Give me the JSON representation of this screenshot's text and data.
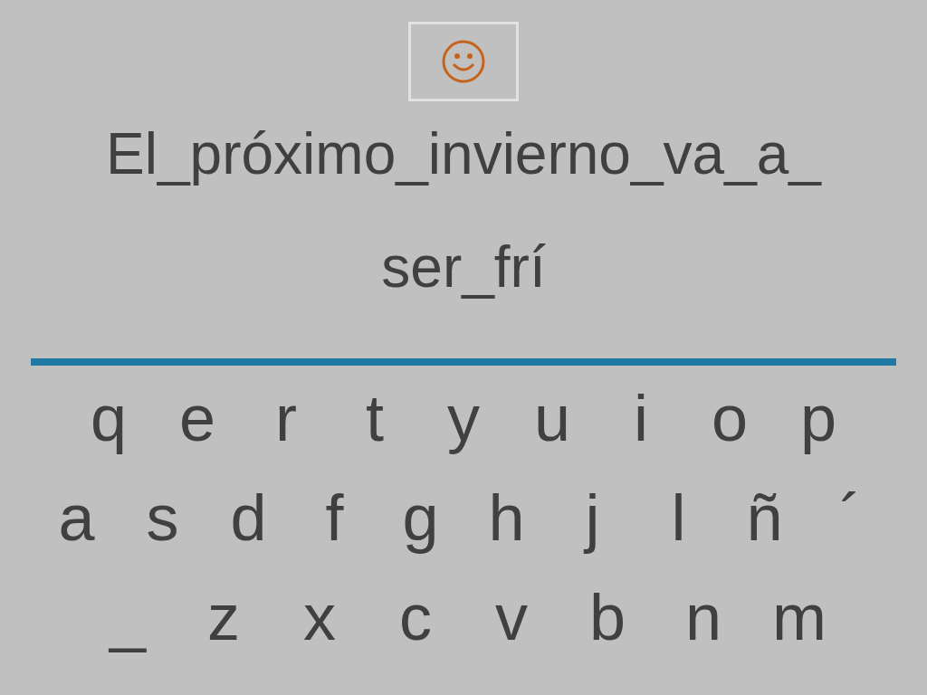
{
  "sentence_lines": [
    "El_próximo_invierno_va_a_",
    "ser_frí"
  ],
  "keyboard": {
    "rows": [
      [
        "q",
        "e",
        "r",
        "t",
        "y",
        "u",
        "i",
        "o",
        "p"
      ],
      [
        "a",
        "s",
        "d",
        "f",
        "g",
        "h",
        "j",
        "l",
        "ñ",
        "´"
      ],
      [
        "_",
        "z",
        "x",
        "c",
        "v",
        "b",
        "n",
        "m"
      ]
    ]
  }
}
